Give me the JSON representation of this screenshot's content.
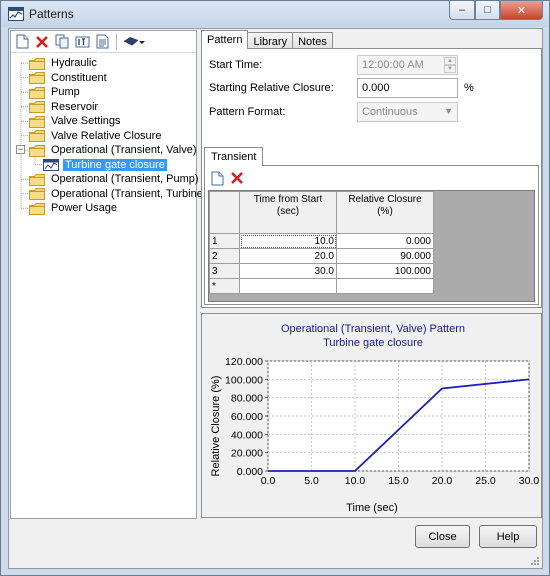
{
  "window": {
    "title": "Patterns",
    "caption_buttons": {
      "minimize": "–",
      "maximize": "□",
      "close": "✕"
    }
  },
  "toolbar": {
    "icons": [
      "new-icon",
      "delete-icon",
      "copy-icon",
      "rename-icon",
      "report-icon",
      "book-icon",
      "dropdown-arrow-icon"
    ]
  },
  "tree": {
    "items": [
      {
        "label": "Hydraulic",
        "level": 1,
        "expander": ""
      },
      {
        "label": "Constituent",
        "level": 1,
        "expander": ""
      },
      {
        "label": "Pump",
        "level": 1,
        "expander": ""
      },
      {
        "label": "Reservoir",
        "level": 1,
        "expander": ""
      },
      {
        "label": "Valve Settings",
        "level": 1,
        "expander": ""
      },
      {
        "label": "Valve Relative Closure",
        "level": 1,
        "expander": ""
      },
      {
        "label": "Operational (Transient, Valve)",
        "level": 1,
        "expander": "−"
      },
      {
        "label": "Turbine gate closure",
        "level": 2,
        "expander": "",
        "selected": true
      },
      {
        "label": "Operational (Transient, Pump)",
        "level": 1,
        "expander": ""
      },
      {
        "label": "Operational (Transient, Turbine)",
        "level": 1,
        "expander": ""
      },
      {
        "label": "Power Usage",
        "level": 1,
        "expander": ""
      }
    ]
  },
  "tabs": [
    "Pattern",
    "Library",
    "Notes"
  ],
  "pattern": {
    "start_time_label": "Start Time:",
    "start_time_value": "12:00:00 AM",
    "starting_closure_label": "Starting Relative Closure:",
    "starting_closure_value": "0.000",
    "starting_closure_unit": "%",
    "format_label": "Pattern Format:",
    "format_value": "Continuous",
    "inner_tab": "Transient"
  },
  "grid": {
    "headers": [
      "Time from Start\n(sec)",
      "Relative Closure\n(%)"
    ],
    "rows": [
      {
        "row": "1",
        "time": "10.0",
        "closure": "0.000"
      },
      {
        "row": "2",
        "time": "20.0",
        "closure": "90.000"
      },
      {
        "row": "3",
        "time": "30.0",
        "closure": "100.000"
      },
      {
        "row": "*",
        "time": "",
        "closure": ""
      }
    ]
  },
  "chart_data": {
    "type": "line",
    "title": "Operational (Transient, Valve) Pattern",
    "subtitle": "Turbine gate closure",
    "xlabel": "Time (sec)",
    "ylabel": "Relative Closure (%)",
    "x": [
      0,
      10,
      20,
      30
    ],
    "series": [
      {
        "values": [
          0,
          0,
          90,
          100
        ]
      }
    ],
    "xlim": [
      0,
      30
    ],
    "ylim": [
      0,
      120
    ],
    "x_ticks": [
      "0.0",
      "5.0",
      "10.0",
      "15.0",
      "20.0",
      "25.0",
      "30.0"
    ],
    "y_ticks": [
      "0.000",
      "20.000",
      "40.000",
      "60.000",
      "80.000",
      "100.000",
      "120.000"
    ],
    "grid": true,
    "line_color": "#1f1fb5",
    "title_color": "#1a1a8c"
  },
  "buttons": {
    "close": "Close",
    "help": "Help"
  }
}
